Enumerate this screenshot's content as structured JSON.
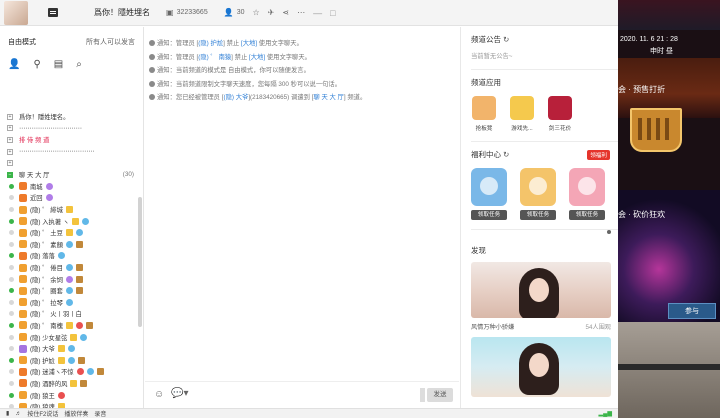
{
  "topbar": {
    "room_name": "爲你！隱姓埋名",
    "room_id": "32233665",
    "online_count": "30"
  },
  "left": {
    "mode": "自由模式",
    "permission": "所有人可以发言",
    "rows": [
      {
        "type": "channel",
        "text": "爲你！隱姓埋名。",
        "style": "normal"
      },
      {
        "type": "channel",
        "text": "⋯⋯⋯⋯⋯⋯⋯⋯⋯⋯",
        "style": "normal"
      },
      {
        "type": "channel",
        "text": "排 侍 频 道",
        "style": "red"
      },
      {
        "type": "channel",
        "text": "⋯⋯⋯⋯⋯⋯⋯⋯⋯⋯⋯⋯",
        "style": "normal"
      },
      {
        "type": "channel",
        "text": "",
        "style": "normal"
      },
      {
        "type": "hall",
        "text": "聊 天 大 厅",
        "count": "(30)"
      },
      {
        "type": "user",
        "text": "南城",
        "icon": "orange",
        "badges": [
          "purple"
        ]
      },
      {
        "type": "user",
        "text": "近回",
        "icon": "orange",
        "badges": [
          "purple"
        ]
      },
      {
        "type": "user",
        "text": "(隐) ゜ 緋城",
        "icon": "crown",
        "badges": [
          "crown"
        ]
      },
      {
        "type": "user",
        "text": "(隐) 入执著 ヽ",
        "icon": "crown",
        "badges": [
          "crown",
          "blue"
        ]
      },
      {
        "type": "user",
        "text": "(隐) ゜ 土豆",
        "icon": "crown",
        "badges": [
          "crown",
          "blue"
        ]
      },
      {
        "type": "user",
        "text": "(隐) ゜ 素顏",
        "icon": "crown",
        "badges": [
          "blue",
          "brown"
        ]
      },
      {
        "type": "user",
        "text": "(隐) 落落",
        "icon": "orange",
        "badges": [
          "blue"
        ]
      },
      {
        "type": "user",
        "text": "(隐) ゜ 倦目",
        "icon": "crown",
        "badges": [
          "blue",
          "brown"
        ]
      },
      {
        "type": "user",
        "text": "(隐) ゜ 余饲",
        "icon": "crown",
        "badges": [
          "purple",
          "brown"
        ]
      },
      {
        "type": "user",
        "text": "(隐) ゜ 圈套",
        "icon": "crown",
        "badges": [
          "blue",
          "brown"
        ]
      },
      {
        "type": "user",
        "text": "(隐) ゜ 拉琴",
        "icon": "crown",
        "badges": [
          "blue"
        ]
      },
      {
        "type": "user",
        "text": "(隐) ゜ 火丨羽丨白",
        "icon": "crown",
        "badges": []
      },
      {
        "type": "user",
        "text": "(隐) ゜ 南槐",
        "icon": "crown",
        "badges": [
          "crown",
          "red",
          "brown"
        ]
      },
      {
        "type": "user",
        "text": "(隐) 少女星弦",
        "icon": "crown",
        "badges": [
          "crown",
          "blue"
        ]
      },
      {
        "type": "user",
        "text": "(隐) 大爷",
        "icon": "purple",
        "badges": [
          "crown",
          "blue"
        ]
      },
      {
        "type": "user",
        "text": "(隐) 护尬",
        "icon": "crown",
        "badges": [
          "crown",
          "blue",
          "brown"
        ]
      },
      {
        "type": "user",
        "text": "(隐) 迷浦ヽ不惊",
        "icon": "orange",
        "badges": [
          "red",
          "blue",
          "brown"
        ]
      },
      {
        "type": "user",
        "text": "(隐) 酒醉的风",
        "icon": "orange",
        "badges": [
          "crown",
          "brown"
        ]
      },
      {
        "type": "user",
        "text": "(隐) 狼王",
        "icon": "crown",
        "badges": [
          "red"
        ]
      },
      {
        "type": "user",
        "text": "(隐) 狼魂",
        "icon": "crown",
        "badges": [
          "crown"
        ]
      }
    ]
  },
  "chat": {
    "messages": [
      {
        "prefix": "通知：管理员 [",
        "name": "(隐) 护尬",
        "mid": "] 禁止 ",
        "target": "[大地]",
        "suffix": " 使用文字聊天。"
      },
      {
        "prefix": "通知：管理员 [",
        "name": "(隐) ゜ 南猿",
        "mid": "] 禁止 ",
        "target": "[大地]",
        "suffix": " 使用文字聊天。"
      },
      {
        "prefix": "通知：当前频道的模式是 自由模式，你可以随便发言。",
        "name": "",
        "mid": "",
        "target": "",
        "suffix": ""
      },
      {
        "prefix": "通知：当前频道限制文字聊天速度，您每隔 300 秒可以说一句话。",
        "name": "",
        "mid": "",
        "target": "",
        "suffix": ""
      },
      {
        "prefix": "通知：您已经被管理员 [",
        "name": "(隐) 大爷",
        "mid": "](2183420665) 调遣到 [",
        "target": "聊 天 大 厅",
        "suffix": "] 频道。"
      }
    ],
    "send_label": "发送"
  },
  "right": {
    "notice_title": "频道公告",
    "notice_text": "当前暂无公告~",
    "apps_title": "频道应用",
    "apps": [
      {
        "label": "抢板凳",
        "color": "#f2b46b"
      },
      {
        "label": "游戏先...",
        "color": "#f5c94d"
      },
      {
        "label": "剑三花价",
        "color": "#b8203a"
      }
    ],
    "welfare_title": "福利中心",
    "welfare_button": "领福利",
    "cards": [
      {
        "label": "领取任务",
        "color": "#7ab8e8"
      },
      {
        "label": "领取任务",
        "color": "#f4c46a"
      },
      {
        "label": "领取任务",
        "color": "#f4a6b6"
      }
    ],
    "discover_title": "发现",
    "live": [
      {
        "title": "风情万种小骄嫌",
        "viewers": "54人围观"
      },
      {
        "title": "",
        "viewers": ""
      }
    ]
  },
  "bottombar": {
    "items": [
      "按住F2说话",
      "播放伴奏",
      "录音"
    ]
  },
  "ad": {
    "date_time": "2020. 11. 6   21 : 28",
    "stamp": "申时 昼",
    "text1": "会 · 预售打折",
    "text2": "会 · 砍价狂欢",
    "join": "参与"
  }
}
